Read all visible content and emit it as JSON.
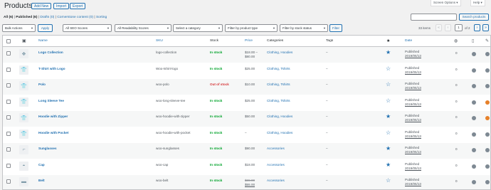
{
  "header": {
    "title": "Products",
    "add_new": "Add New",
    "import": "Import",
    "export": "Export",
    "screen_options": "Screen Options ▾",
    "help": "Help ▾"
  },
  "views": {
    "all": "All",
    "all_count": "(6)",
    "published": "Published",
    "published_count": "(6)",
    "drafts": "Drafts",
    "drafts_count": "(0)",
    "cornerstone": "Cornerstone content",
    "cornerstone_count": "(0)",
    "sorting": "Sorting",
    "sep": "|"
  },
  "search": {
    "button": "Search products"
  },
  "filters": {
    "bulk": "Bulk Actions",
    "apply": "Apply",
    "seo": "All SEO Scores",
    "readability": "All Readability Scores",
    "category": "Select a category",
    "product_type": "Filter by product type",
    "stock_status": "Filter by stock status",
    "filter": "Filter"
  },
  "pagination": {
    "items": "33 items",
    "first": "«",
    "prev": "‹",
    "current": "1",
    "of": "of 2",
    "next": "›",
    "last": "»"
  },
  "columns": {
    "name": "Name",
    "sku": "SKU",
    "stock": "Stock",
    "price": "Price",
    "categories": "Categories",
    "tags": "Tags",
    "date": "Date"
  },
  "rows": [
    {
      "name": "Logo Collection",
      "sku": "logo-collection",
      "stock": "In stock",
      "in_stock": true,
      "price": "$18.00 –",
      "price2": "$80.00",
      "sale": false,
      "cats": "Clothing, Hoodies",
      "tags": "–",
      "featured": true,
      "status": "Published",
      "date": "2019/05/13",
      "count": "0",
      "seo": "grey",
      "read": "grey",
      "thumb": "icons"
    },
    {
      "name": "T-Shirt with Logo",
      "sku": "Woo-tshirt-logo",
      "stock": "In stock",
      "in_stock": true,
      "price": "$25.00",
      "price2": "",
      "sale": false,
      "cats": "Clothing, Tshirts",
      "tags": "–",
      "featured": false,
      "status": "Published",
      "date": "2019/05/13",
      "count": "0",
      "seo": "grey",
      "read": "grey",
      "thumb": "tshirt"
    },
    {
      "name": "Polo",
      "sku": "woo-polo",
      "stock": "Out of stock",
      "in_stock": false,
      "price": "$10.00",
      "price2": "",
      "sale": false,
      "cats": "Clothing, Tshirts",
      "tags": "–",
      "featured": false,
      "status": "Published",
      "date": "2019/05/13",
      "count": "0",
      "seo": "grey",
      "read": "grey",
      "thumb": "polo"
    },
    {
      "name": "Long Sleeve Tee",
      "sku": "woo-long-sleeve-tee",
      "stock": "In stock",
      "in_stock": true,
      "price": "$25.00",
      "price2": "",
      "sale": false,
      "cats": "Clothing, Tshirts",
      "tags": "–",
      "featured": false,
      "status": "Published",
      "date": "2019/05/13",
      "count": "0",
      "seo": "grey",
      "read": "orange",
      "thumb": "longsleeve"
    },
    {
      "name": "Hoodie with Zipper",
      "sku": "woo-hoodie-with-zipper",
      "stock": "In stock",
      "in_stock": true,
      "price": "$50.00",
      "price2": "",
      "sale": false,
      "cats": "Clothing, Hoodies",
      "tags": "–",
      "featured": true,
      "status": "Published",
      "date": "2019/05/13",
      "count": "0",
      "seo": "grey",
      "read": "orange",
      "thumb": "hoodie"
    },
    {
      "name": "Hoodie with Pocket",
      "sku": "woo-hoodie-with-pocket",
      "stock": "In stock",
      "in_stock": true,
      "price": "–",
      "price2": "",
      "sale": false,
      "cats": "Clothing, Hoodies",
      "tags": "–",
      "featured": false,
      "status": "Published",
      "date": "2019/05/13",
      "count": "0",
      "seo": "grey",
      "read": "grey",
      "thumb": "hoodie"
    },
    {
      "name": "Sunglasses",
      "sku": "woo-sunglasses",
      "stock": "In stock",
      "in_stock": true,
      "price": "$90.00",
      "price2": "",
      "sale": false,
      "cats": "Accessories",
      "tags": "–",
      "featured": true,
      "status": "Published",
      "date": "2019/05/13",
      "count": "0",
      "seo": "grey",
      "read": "grey",
      "thumb": "sunglasses"
    },
    {
      "name": "Cap",
      "sku": "woo-cap",
      "stock": "In stock",
      "in_stock": true,
      "price": "$18.00",
      "price2": "",
      "sale": false,
      "cats": "Accessories",
      "tags": "–",
      "featured": true,
      "status": "Published",
      "date": "2019/05/13",
      "count": "0",
      "seo": "grey",
      "read": "grey",
      "thumb": "cap"
    },
    {
      "name": "Belt",
      "sku": "woo-belt",
      "stock": "In stock",
      "in_stock": true,
      "price": "$65.00",
      "price2": "$55.00",
      "sale": true,
      "cats": "Accessories",
      "tags": "–",
      "featured": false,
      "status": "Published",
      "date": "2019/05/13",
      "count": "0",
      "seo": "grey",
      "read": "grey",
      "thumb": "belt"
    }
  ],
  "colors": {
    "link": "#2271b1",
    "in_stock": "#00a32a",
    "out_stock": "#d63638",
    "orange": "#e6812a"
  }
}
